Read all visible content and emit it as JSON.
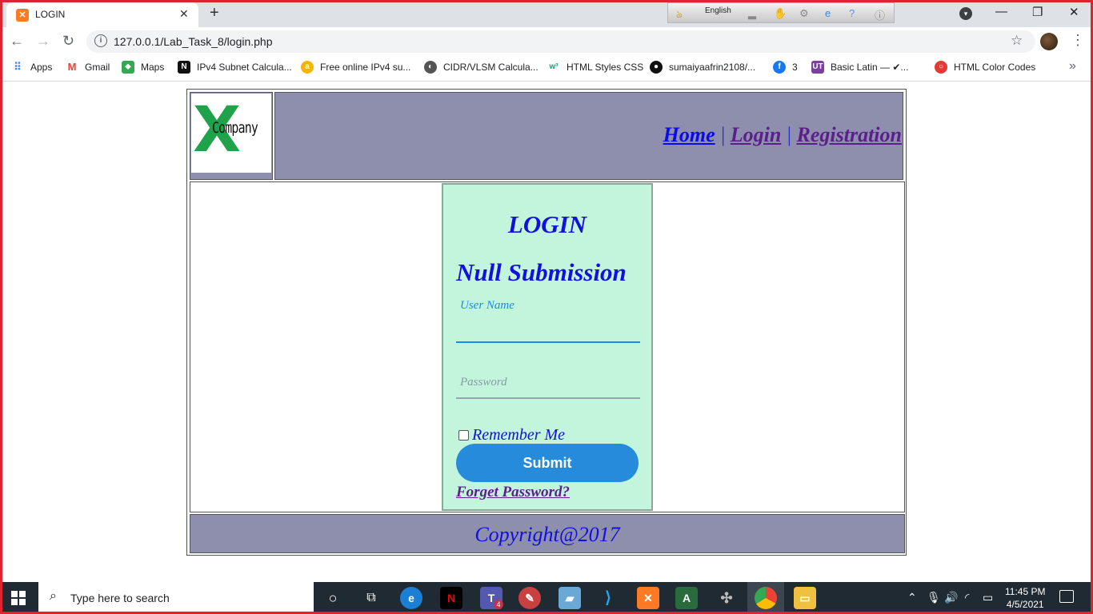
{
  "browser": {
    "tab_title": "LOGIN",
    "tab_favicon": "xampp-icon",
    "url": "127.0.0.1/Lab_Task_8/login.php",
    "ime_language": "English"
  },
  "bookmarks": [
    {
      "label": "Apps",
      "icon": "apps-grid-icon",
      "color": "#4285f4"
    },
    {
      "label": "Gmail",
      "icon": "gmail-icon",
      "color": "#ea4335"
    },
    {
      "label": "Maps",
      "icon": "maps-icon",
      "color": "#34a853"
    },
    {
      "label": "IPv4 Subnet Calcula...",
      "icon": "n-icon",
      "color": "#111111"
    },
    {
      "label": "Free online IPv4 su...",
      "icon": "a-icon",
      "color": "#f4b400"
    },
    {
      "label": "CIDR/VLSM Calcula...",
      "icon": "globe-icon",
      "color": "#555555"
    },
    {
      "label": "HTML Styles CSS",
      "icon": "w3-icon",
      "color": "#04aa6d"
    },
    {
      "label": "sumaiyaafrin2108/...",
      "icon": "github-icon",
      "color": "#111111"
    },
    {
      "label": "3",
      "icon": "facebook-icon",
      "color": "#1877f2"
    },
    {
      "label": "Basic Latin — ✔...",
      "icon": "ut-icon",
      "color": "#7b3fa0"
    },
    {
      "label": "HTML Color Codes",
      "icon": "color-codes-icon",
      "color": "#e53935"
    }
  ],
  "site": {
    "logo_letter": "X",
    "logo_word": "Company",
    "nav": {
      "home": "Home",
      "sep1": "|",
      "login": "Login",
      "sep2": "|",
      "registration": "Registration"
    },
    "login": {
      "title": "LOGIN",
      "error": "Null Submission",
      "username_label": "User Name",
      "password_label": "Password",
      "remember_label": "Remember Me",
      "submit_label": "Submit",
      "forget_label": "Forget Password?"
    },
    "footer": "Copyright@2017"
  },
  "taskbar": {
    "search_placeholder": "Type here to search",
    "time": "11:45 PM",
    "date": "4/5/2021",
    "teams_badge": "4"
  },
  "colors": {
    "header_bg": "#8e8ead",
    "login_bg": "#c2f5dc",
    "button_bg": "#268bdb",
    "text_blue": "#1010e0"
  }
}
